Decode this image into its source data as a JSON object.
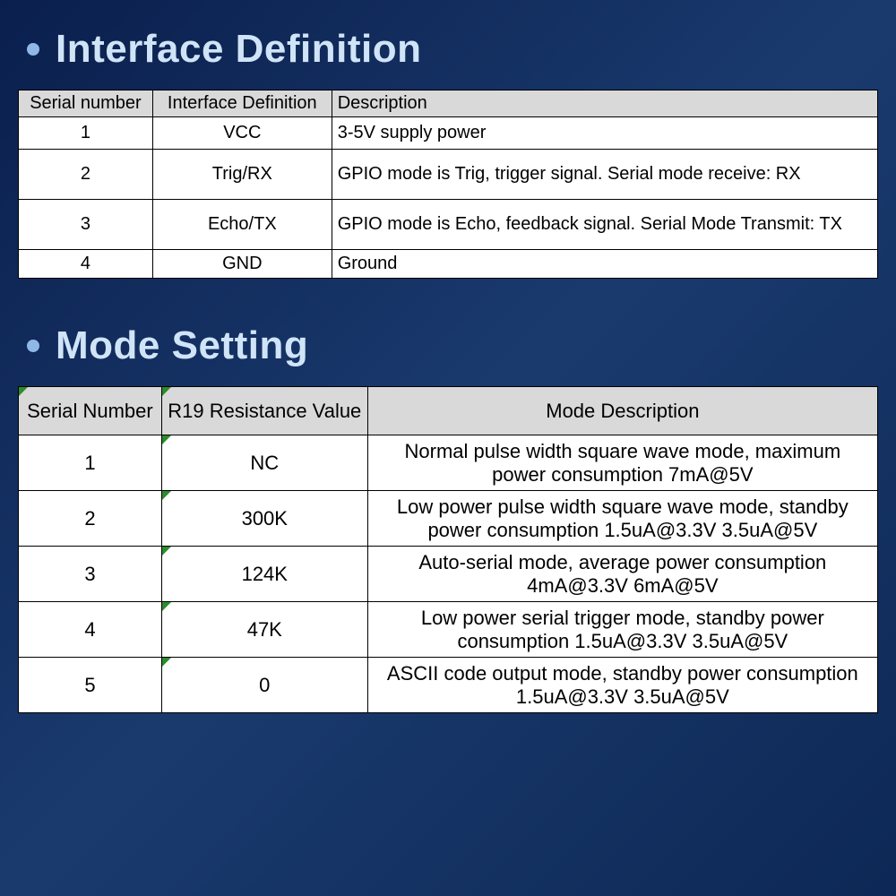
{
  "sections": {
    "interface": {
      "heading": "Interface Definition",
      "headers": {
        "serial": "Serial number",
        "definition": "Interface Definition",
        "description": "Description"
      },
      "rows": [
        {
          "sn": "1",
          "def": "VCC",
          "desc": "3-5V supply power"
        },
        {
          "sn": "2",
          "def": "Trig/RX",
          "desc": "GPIO mode is Trig, trigger signal. Serial mode receive: RX"
        },
        {
          "sn": "3",
          "def": "Echo/TX",
          "desc": "GPIO mode is Echo, feedback signal. Serial Mode Transmit: TX"
        },
        {
          "sn": "4",
          "def": "GND",
          "desc": "Ground"
        }
      ]
    },
    "mode": {
      "heading": "Mode Setting",
      "headers": {
        "serial": "Serial Number",
        "resistance": "R19 Resistance Value",
        "description": "Mode Description"
      },
      "rows": [
        {
          "sn": "1",
          "res": "NC",
          "mdesc": "Normal pulse width square wave mode, maximum power consumption 7mA@5V"
        },
        {
          "sn": "2",
          "res": "300K",
          "mdesc": "Low power pulse width square wave mode, standby power consumption  1.5uA@3.3V  3.5uA@5V"
        },
        {
          "sn": "3",
          "res": "124K",
          "mdesc": "Auto-serial mode, average power consumption 4mA@3.3V  6mA@5V"
        },
        {
          "sn": "4",
          "res": "47K",
          "mdesc": "Low power serial trigger mode, standby power consumption 1.5uA@3.3V  3.5uA@5V"
        },
        {
          "sn": "5",
          "res": "0",
          "mdesc": "ASCII code output mode, standby power consumption 1.5uA@3.3V  3.5uA@5V"
        }
      ]
    }
  }
}
